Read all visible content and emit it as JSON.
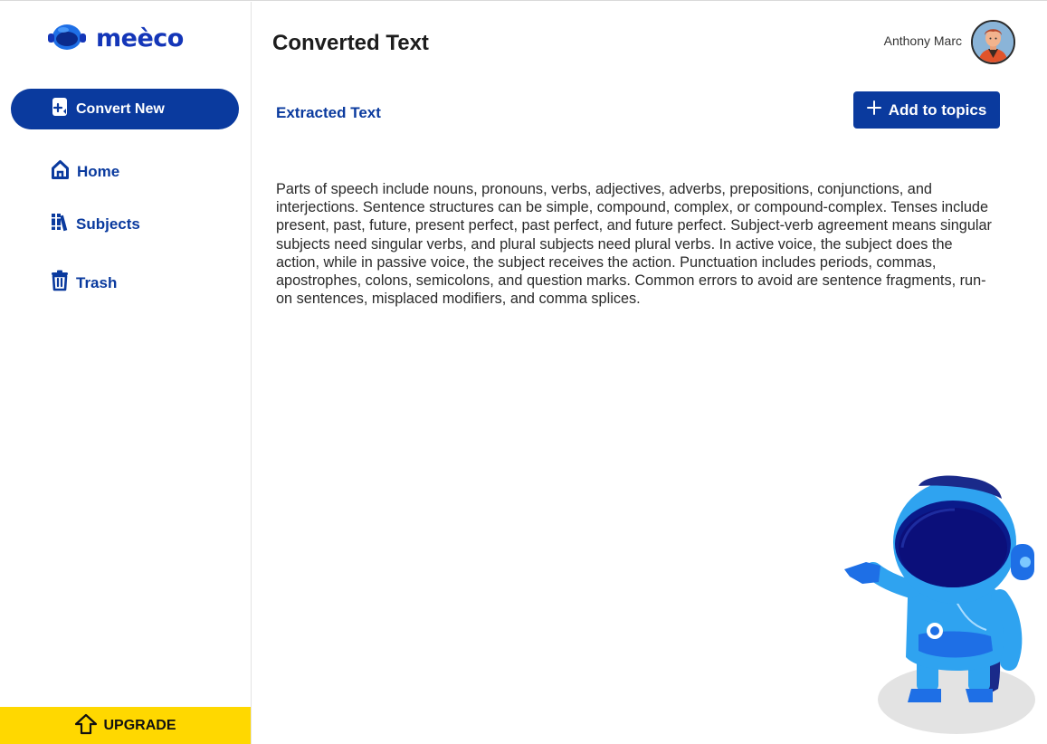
{
  "sidebar": {
    "logo_text": "meèco",
    "convert_label": "Convert New",
    "nav": {
      "home": "Home",
      "subjects": "Subjects",
      "trash": "Trash"
    },
    "upgrade_label": "UPGRADE"
  },
  "header": {
    "title": "Converted Text",
    "user_name": "Anthony Marc"
  },
  "main": {
    "section_label": "Extracted Text",
    "add_button_label": "Add to topics",
    "extracted_text": "Parts of speech include nouns, pronouns, verbs, adjectives, adverbs, prepositions, conjunctions, and interjections. Sentence structures can be simple, compound, complex, or compound-complex. Tenses include present, past, future, present perfect, past perfect, and future perfect. Subject-verb agreement means singular subjects need singular verbs, and plural subjects need plural verbs. In active voice, the subject does the action, while in passive voice, the subject receives the action. Punctuation includes periods, commas, apostrophes, colons, semicolons, and question marks. Common errors to avoid are sentence fragments, run-on sentences, misplaced modifiers, and comma splices."
  },
  "icons": {
    "logo": "helmet-logo-icon",
    "convert": "document-plus-icon",
    "home": "home-icon",
    "subjects": "books-icon",
    "trash": "trash-icon",
    "upgrade": "upgrade-arrow-icon",
    "add": "plus-icon",
    "avatar": "user-avatar",
    "mascot": "astronaut-mascot"
  },
  "colors": {
    "primary": "#0a3a9e",
    "logo_blue": "#1436b8",
    "upgrade_yellow": "#ffd800",
    "mascot_blue": "#2fa3f0"
  }
}
